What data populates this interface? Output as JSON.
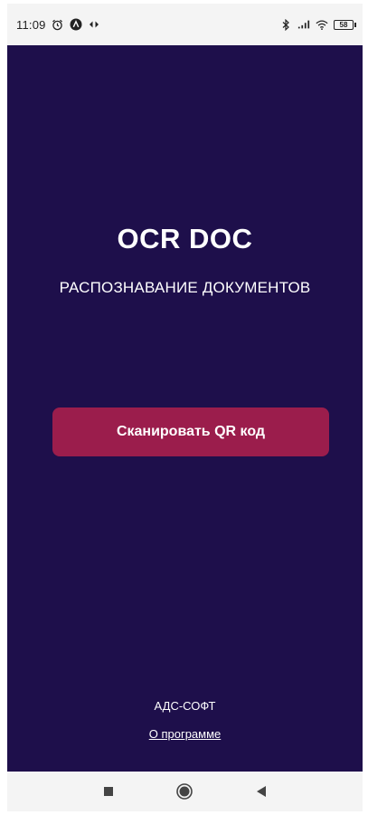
{
  "status_bar": {
    "time": "11:09",
    "battery": "58",
    "icons": [
      "alarm-icon",
      "app-notification-icon",
      "cast-icon",
      "bluetooth-icon",
      "signal-icon",
      "wifi-icon",
      "battery-icon"
    ]
  },
  "app": {
    "title": "OCR DOC",
    "subtitle": "РАСПОЗНАВАНИЕ ДОКУМЕНТОВ",
    "scan_button_label": "Сканировать QR код",
    "company": "АДС-СОФТ",
    "about_link": "О программе",
    "colors": {
      "background": "#1e0f4b",
      "button": "#9b1d4c",
      "text": "#ffffff"
    }
  },
  "nav_bar": {
    "buttons": [
      "recents-square-icon",
      "home-circle-icon",
      "back-triangle-icon"
    ]
  }
}
